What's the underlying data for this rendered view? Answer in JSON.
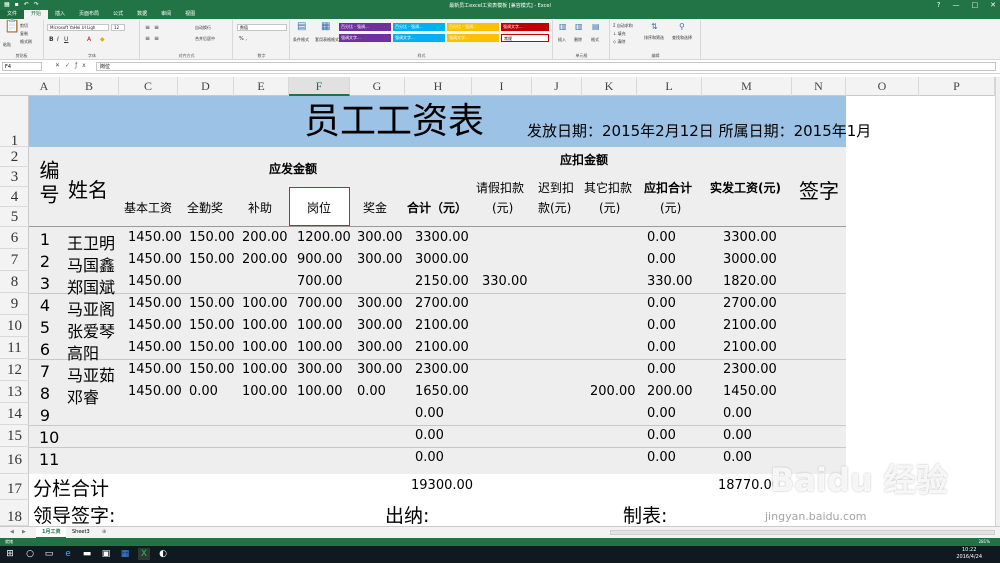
{
  "window": {
    "title": "最新员工excel工资表模板 [兼容模式] - Excel",
    "controls": [
      "?",
      "—",
      "□",
      "✕"
    ]
  },
  "tabs": [
    "文件",
    "开始",
    "插入",
    "页面布局",
    "公式",
    "数据",
    "审阅",
    "视图"
  ],
  "ribbon": {
    "clipboard": {
      "paste": "粘贴",
      "cut": "剪切",
      "copy": "复制",
      "format_painter": "格式刷",
      "label": "剪贴板"
    },
    "font": {
      "name": "Microsoft YaHei UI Ligh",
      "size": "12",
      "label": "字体"
    },
    "alignment": {
      "wrap": "自动换行",
      "merge": "合并后居中",
      "label": "对齐方式"
    },
    "number": {
      "format": "数值",
      "label": "数字"
    },
    "styles": {
      "cond_format": "条件格式",
      "table_format": "套用表格格式",
      "label": "样式",
      "boxes": [
        {
          "text": "百分比 - 强调...",
          "color": "#7030a0"
        },
        {
          "text": "百分比 - 强调...",
          "color": "#00b0f0"
        },
        {
          "text": "百分比 - 强调...",
          "color": "#ffc000"
        },
        {
          "text": "强调文字...",
          "color": "#c00000"
        },
        {
          "text": "强调文字...",
          "color": "#7030a0"
        },
        {
          "text": "强调文字...",
          "color": "#00b0f0"
        },
        {
          "text": "强调文字...",
          "color": "#ffc000"
        },
        {
          "text": "常规",
          "color": "#ffffff"
        }
      ]
    },
    "cells": {
      "insert": "插入",
      "delete": "删除",
      "format": "格式",
      "label": "单元格"
    },
    "editing": {
      "autosum": "自动求和",
      "fill": "填充",
      "clear": "清除",
      "sort": "排序和筛选",
      "find": "查找和选择",
      "label": "编辑"
    }
  },
  "formula_bar": {
    "name_box": "F4",
    "value": "岗位"
  },
  "columns": [
    "A",
    "B",
    "C",
    "D",
    "E",
    "F",
    "G",
    "H",
    "I",
    "J",
    "K",
    "L",
    "M",
    "N",
    "O",
    "P"
  ],
  "rows": [
    "1",
    "2",
    "3",
    "4",
    "5",
    "6",
    "7",
    "8",
    "9",
    "10",
    "11",
    "12",
    "13",
    "14",
    "15",
    "16",
    "17",
    "18"
  ],
  "sheet": {
    "title": "员工工资表",
    "date_line": "发放日期：2015年2月12日 所属日期：2015年1月",
    "headers": {
      "id": "编号",
      "name": "姓名",
      "payable_group": "应发金额",
      "deduct_group": "应扣金额",
      "base": "基本工资",
      "attendance": "全勤奖",
      "allowance": "补助",
      "position": "岗位",
      "bonus": "奖金",
      "total": "合计（元）",
      "leave_1": "请假扣款",
      "leave_2": "(元)",
      "late_1": "迟到扣",
      "late_2": "款(元)",
      "other_1": "其它扣款",
      "other_2": "(元)",
      "deduct_total_1": "应扣合计",
      "deduct_total_2": "(元)",
      "net": "实发工资(元)",
      "sign": "签字"
    },
    "data": [
      {
        "id": "1",
        "name": "王卫明",
        "base": "1450.00",
        "att": "150.00",
        "allow": "200.00",
        "pos": "1200.00",
        "bonus": "300.00",
        "total": "3300.00",
        "leave": "",
        "late": "",
        "other": "",
        "dtotal": "0.00",
        "net": "3300.00"
      },
      {
        "id": "2",
        "name": "马国鑫",
        "base": "1450.00",
        "att": "150.00",
        "allow": "200.00",
        "pos": "900.00",
        "bonus": "300.00",
        "total": "3000.00",
        "leave": "",
        "late": "",
        "other": "",
        "dtotal": "0.00",
        "net": "3000.00"
      },
      {
        "id": "3",
        "name": "郑国斌",
        "base": "1450.00",
        "att": "",
        "allow": "",
        "pos": "700.00",
        "bonus": "",
        "total": "2150.00",
        "leave": "330.00",
        "late": "",
        "other": "",
        "dtotal": "330.00",
        "net": "1820.00"
      },
      {
        "id": "4",
        "name": "马亚阁",
        "base": "1450.00",
        "att": "150.00",
        "allow": "100.00",
        "pos": "700.00",
        "bonus": "300.00",
        "total": "2700.00",
        "leave": "",
        "late": "",
        "other": "",
        "dtotal": "0.00",
        "net": "2700.00"
      },
      {
        "id": "5",
        "name": "张爱琴",
        "base": "1450.00",
        "att": "150.00",
        "allow": "100.00",
        "pos": "100.00",
        "bonus": "300.00",
        "total": "2100.00",
        "leave": "",
        "late": "",
        "other": "",
        "dtotal": "0.00",
        "net": "2100.00"
      },
      {
        "id": "6",
        "name": "高阳",
        "base": "1450.00",
        "att": "150.00",
        "allow": "100.00",
        "pos": "100.00",
        "bonus": "300.00",
        "total": "2100.00",
        "leave": "",
        "late": "",
        "other": "",
        "dtotal": "0.00",
        "net": "2100.00"
      },
      {
        "id": "7",
        "name": "马亚茹",
        "base": "1450.00",
        "att": "150.00",
        "allow": "100.00",
        "pos": "300.00",
        "bonus": "300.00",
        "total": "2300.00",
        "leave": "",
        "late": "",
        "other": "",
        "dtotal": "0.00",
        "net": "2300.00"
      },
      {
        "id": "8",
        "name": "邓睿",
        "base": "1450.00",
        "att": "0.00",
        "allow": "100.00",
        "pos": "100.00",
        "bonus": "0.00",
        "total": "1650.00",
        "leave": "",
        "late": "",
        "other": "200.00",
        "dtotal": "200.00",
        "net": "1450.00"
      },
      {
        "id": "9",
        "name": "",
        "base": "",
        "att": "",
        "allow": "",
        "pos": "",
        "bonus": "",
        "total": "0.00",
        "leave": "",
        "late": "",
        "other": "",
        "dtotal": "0.00",
        "net": "0.00"
      },
      {
        "id": "10",
        "name": "",
        "base": "",
        "att": "",
        "allow": "",
        "pos": "",
        "bonus": "",
        "total": "0.00",
        "leave": "",
        "late": "",
        "other": "",
        "dtotal": "0.00",
        "net": "0.00"
      },
      {
        "id": "11",
        "name": "",
        "base": "",
        "att": "",
        "allow": "",
        "pos": "",
        "bonus": "",
        "total": "0.00",
        "leave": "",
        "late": "",
        "other": "",
        "dtotal": "0.00",
        "net": "0.00"
      }
    ],
    "subtotal_label": "分栏合计",
    "subtotal_total": "19300.00",
    "subtotal_net": "18770.00",
    "leader_sign": "领导签字:",
    "cashier": "出纳:",
    "preparer": "制表:"
  },
  "sheet_tabs": [
    "1月工资",
    "Sheet3"
  ],
  "status": {
    "ready": "就绪",
    "zoom": "281%"
  },
  "taskbar": {
    "time": "10:22",
    "date": "2016/4/24"
  },
  "watermark": {
    "logo": "Baidu 经验",
    "url": "jingyan.baidu.com"
  }
}
